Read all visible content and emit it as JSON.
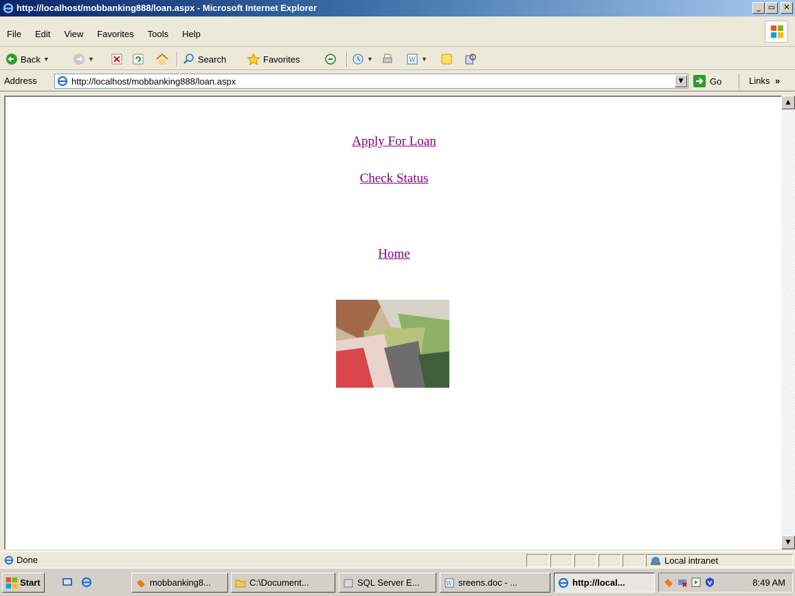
{
  "window": {
    "title": "http://localhost/mobbanking888/loan.aspx - Microsoft Internet Explorer"
  },
  "menu": {
    "items": [
      "File",
      "Edit",
      "View",
      "Favorites",
      "Tools",
      "Help"
    ]
  },
  "toolbar": {
    "back_label": "Back",
    "search_label": "Search",
    "favorites_label": "Favorites"
  },
  "address": {
    "label": "Address",
    "url": "http://localhost/mobbanking888/loan.aspx",
    "go_label": "Go",
    "links_label": "Links"
  },
  "page": {
    "links": [
      "Apply For Loan",
      "Check Status",
      "Home"
    ],
    "link_color": "#800080"
  },
  "status": {
    "text": "Done",
    "zone": "Local intranet"
  },
  "taskbar": {
    "start_label": "start",
    "tasks": [
      "mobbanking8...",
      "C:\\Document...",
      "SQL Server E...",
      "sreens.doc - ...",
      "http://local..."
    ],
    "clock": "8:49 AM"
  }
}
